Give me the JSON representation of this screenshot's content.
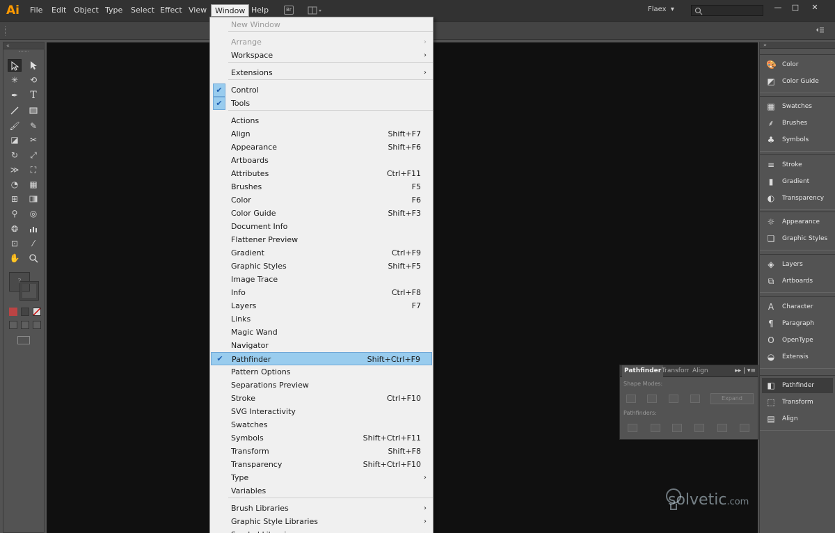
{
  "app": {
    "logo": "Ai",
    "workspace": "Flaex",
    "workspace_arrow": "▾"
  },
  "menubar": {
    "items": [
      "File",
      "Edit",
      "Object",
      "Type",
      "Select",
      "Effect",
      "View",
      "Window",
      "Help"
    ],
    "bridge_badge": "Br",
    "window_controls": {
      "minimize": "—",
      "restore": "□",
      "close": "✕"
    }
  },
  "window_menu": {
    "items": [
      {
        "label": "New Window",
        "disabled": true
      },
      {
        "label": "Arrange",
        "disabled": true,
        "submenu": true
      },
      {
        "label": "Workspace",
        "submenu": true
      },
      {
        "label": "Extensions",
        "submenu": true
      },
      {
        "label": "Control",
        "checked": true
      },
      {
        "label": "Tools",
        "checked": true
      },
      {
        "label": "Actions"
      },
      {
        "label": "Align",
        "shortcut": "Shift+F7"
      },
      {
        "label": "Appearance",
        "shortcut": "Shift+F6"
      },
      {
        "label": "Artboards"
      },
      {
        "label": "Attributes",
        "shortcut": "Ctrl+F11"
      },
      {
        "label": "Brushes",
        "shortcut": "F5"
      },
      {
        "label": "Color",
        "shortcut": "F6"
      },
      {
        "label": "Color Guide",
        "shortcut": "Shift+F3"
      },
      {
        "label": "Document Info"
      },
      {
        "label": "Flattener Preview"
      },
      {
        "label": "Gradient",
        "shortcut": "Ctrl+F9"
      },
      {
        "label": "Graphic Styles",
        "shortcut": "Shift+F5"
      },
      {
        "label": "Image Trace"
      },
      {
        "label": "Info",
        "shortcut": "Ctrl+F8"
      },
      {
        "label": "Layers",
        "shortcut": "F7"
      },
      {
        "label": "Links"
      },
      {
        "label": "Magic Wand"
      },
      {
        "label": "Navigator"
      },
      {
        "label": "Pathfinder",
        "shortcut": "Shift+Ctrl+F9",
        "checked": true,
        "highlighted": true
      },
      {
        "label": "Pattern Options"
      },
      {
        "label": "Separations Preview"
      },
      {
        "label": "Stroke",
        "shortcut": "Ctrl+F10"
      },
      {
        "label": "SVG Interactivity"
      },
      {
        "label": "Swatches"
      },
      {
        "label": "Symbols",
        "shortcut": "Shift+Ctrl+F11"
      },
      {
        "label": "Transform",
        "shortcut": "Shift+F8"
      },
      {
        "label": "Transparency",
        "shortcut": "Shift+Ctrl+F10"
      },
      {
        "label": "Type",
        "submenu": true
      },
      {
        "label": "Variables"
      },
      {
        "label": "Brush Libraries",
        "submenu": true
      },
      {
        "label": "Graphic Style Libraries",
        "submenu": true
      },
      {
        "label": "Symbol Libraries",
        "submenu": true
      }
    ]
  },
  "dock": {
    "groups": [
      [
        {
          "label": "Color",
          "icon": "color-icon"
        },
        {
          "label": "Color Guide",
          "icon": "color-guide-icon"
        }
      ],
      [
        {
          "label": "Swatches",
          "icon": "swatches-icon"
        },
        {
          "label": "Brushes",
          "icon": "brushes-icon"
        },
        {
          "label": "Symbols",
          "icon": "symbols-icon"
        }
      ],
      [
        {
          "label": "Stroke",
          "icon": "stroke-icon"
        },
        {
          "label": "Gradient",
          "icon": "gradient-icon"
        },
        {
          "label": "Transparency",
          "icon": "transparency-icon"
        }
      ],
      [
        {
          "label": "Appearance",
          "icon": "appearance-icon"
        },
        {
          "label": "Graphic Styles",
          "icon": "graphic-styles-icon"
        }
      ],
      [
        {
          "label": "Layers",
          "icon": "layers-icon"
        },
        {
          "label": "Artboards",
          "icon": "artboards-icon"
        }
      ],
      [
        {
          "label": "Character",
          "icon": "character-icon"
        },
        {
          "label": "Paragraph",
          "icon": "paragraph-icon"
        },
        {
          "label": "OpenType",
          "icon": "opentype-icon"
        },
        {
          "label": "Extensis",
          "icon": "extensis-icon"
        }
      ],
      [
        {
          "label": "Pathfinder",
          "icon": "pathfinder-icon",
          "active": true
        },
        {
          "label": "Transform",
          "icon": "transform-icon"
        },
        {
          "label": "Align",
          "icon": "align-icon"
        }
      ]
    ]
  },
  "pathfinder_panel": {
    "tabs": [
      "Pathfinder",
      "Transform",
      "Align"
    ],
    "shape_modes_label": "Shape Modes:",
    "pathfinders_label": "Pathfinders:",
    "expand_label": "Expand"
  },
  "toolbar": {
    "fill_stroke_unknown": "?"
  },
  "watermark": {
    "text": "solvetic",
    "suffix": ".com"
  }
}
